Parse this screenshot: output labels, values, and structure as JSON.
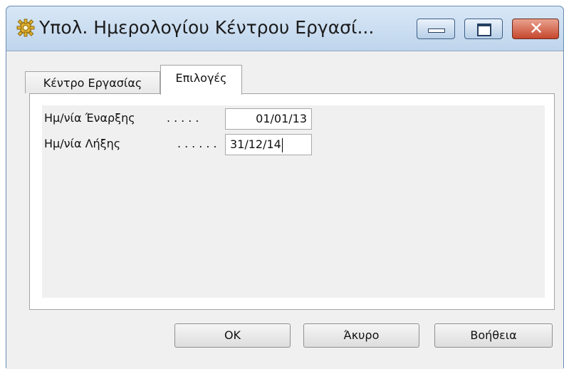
{
  "window": {
    "title": "Υπολ. Ημερολογίου Κέντρου Εργασί...",
    "icon": "gear-icon",
    "controls": {
      "minimize": "minimize-icon",
      "maximize": "maximize-icon",
      "close": "✕"
    }
  },
  "tabs": [
    {
      "label": "Κέντρο Εργασίας",
      "active": false
    },
    {
      "label": "Επιλογές",
      "active": true
    }
  ],
  "form": {
    "start_label": "Ημ/νία Έναρξης",
    "start_dots": ".....",
    "start_value": "01/01/13",
    "end_label": "Ημ/νία Λήξης",
    "end_dots": "......",
    "end_value": "31/12/14"
  },
  "buttons": {
    "ok": "OK",
    "cancel": "Άκυρο",
    "help": "Βοήθεια"
  },
  "colors": {
    "titlebar": "#bfd5ec",
    "close_button": "#c7462d",
    "panel": "#f0f0f0"
  }
}
